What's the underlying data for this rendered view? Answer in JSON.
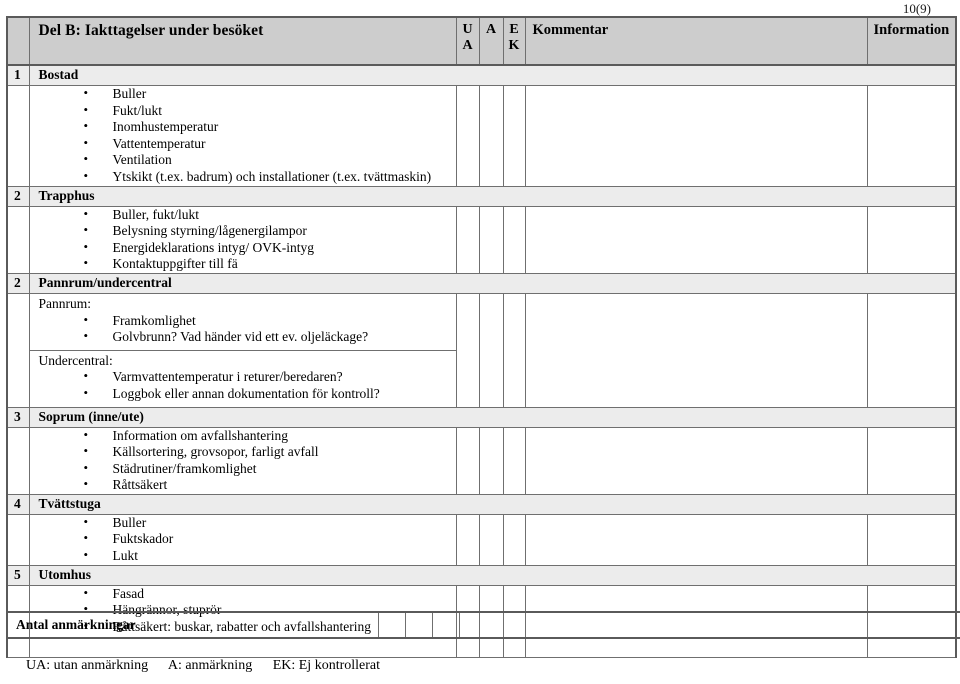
{
  "page_number": "10(9)",
  "header": {
    "title": "Del B: Iakttagelser under besöket",
    "col_ua_line1": "U",
    "col_ua_line2": "A",
    "col_a": "A",
    "col_ek_line1": "E",
    "col_ek_line2": "K",
    "col_kommentar": "Kommentar",
    "col_information": "Information"
  },
  "sections": [
    {
      "number": "1",
      "title": "Bostad",
      "groups": [
        {
          "label": "",
          "items": [
            "Buller",
            "Fukt/lukt",
            "Inomhustemperatur",
            "Vattentemperatur",
            "Ventilation",
            "Ytskikt (t.ex. badrum) och installationer (t.ex. tvättmaskin)"
          ]
        }
      ]
    },
    {
      "number": "2",
      "title": "Trapphus",
      "groups": [
        {
          "label": "",
          "items": [
            "Buller, fukt/lukt",
            "Belysning styrning/lågenergilampor",
            "Energideklarations intyg/ OVK-intyg",
            "Kontaktuppgifter till fä"
          ]
        }
      ]
    },
    {
      "number": "2",
      "title": "Pannrum/undercentral",
      "groups": [
        {
          "label": "Pannrum:",
          "items": [
            "Framkomlighet",
            "Golvbrunn? Vad händer vid ett ev. oljeläckage?"
          ]
        },
        {
          "label": "Undercentral:",
          "items": [
            "Varmvattentemperatur i returer/beredaren?",
            "Loggbok eller annan dokumentation för kontroll?"
          ]
        }
      ]
    },
    {
      "number": "3",
      "title": "Soprum (inne/ute)",
      "groups": [
        {
          "label": "",
          "items": [
            "Information om avfallshantering",
            "Källsortering, grovsopor, farligt avfall",
            "Städrutiner/framkomlighet",
            "Råttsäkert"
          ]
        }
      ]
    },
    {
      "number": "4",
      "title": "Tvättstuga",
      "groups": [
        {
          "label": "",
          "items": [
            "Buller",
            "Fuktskador",
            "Lukt"
          ]
        }
      ]
    },
    {
      "number": "5",
      "title": "Utomhus",
      "groups": [
        {
          "label": "",
          "items": [
            "Fasad",
            "Hängrännor, stuprör",
            "Råttsäkert: buskar, rabatter och avfallshantering"
          ]
        }
      ]
    }
  ],
  "totals": {
    "label": "Antal anmärkningar",
    "box_ua": "",
    "box_a": "",
    "box_ek": "",
    "box_rest": ""
  },
  "legend": {
    "ua": "UA: utan anmärkning",
    "a": "A: anmärkning",
    "ek": "EK: Ej kontrollerat"
  },
  "colors": {
    "header_band": "#cdcdcd",
    "section_band": "#ececec",
    "border": "#6f6f6f",
    "outer_border": "#5a5a5a"
  }
}
